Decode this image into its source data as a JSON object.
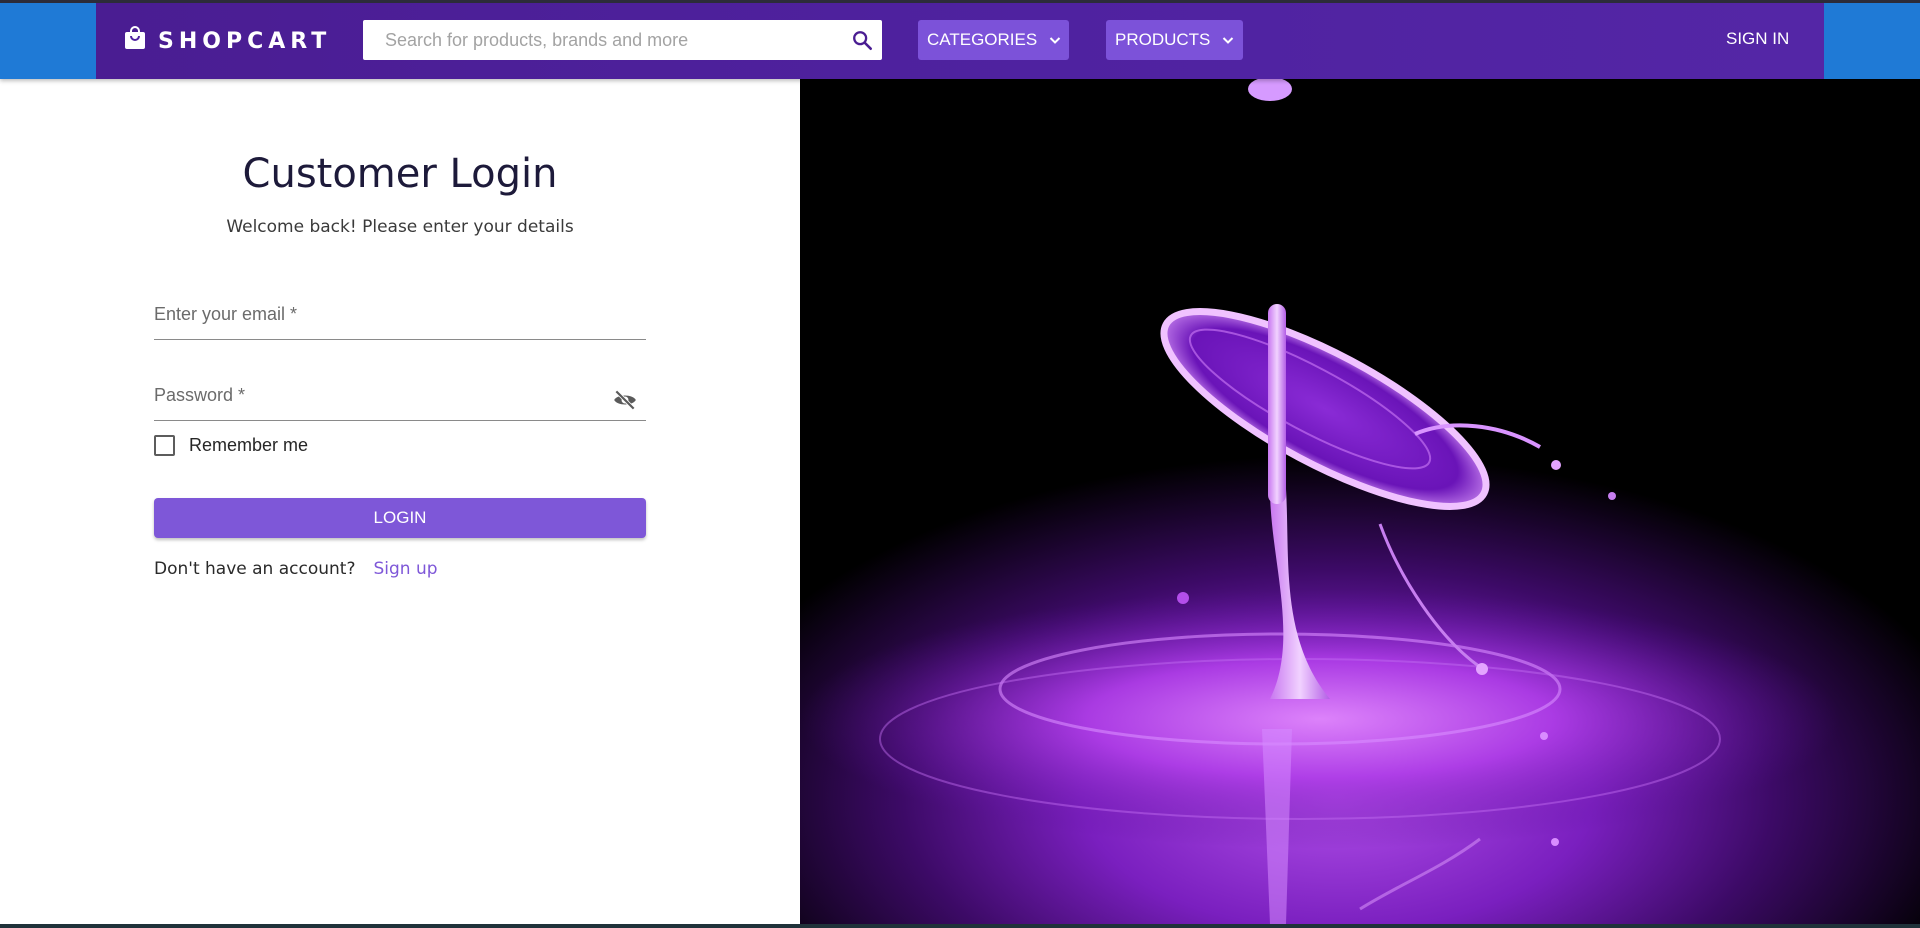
{
  "header": {
    "brand": "SHOPCART",
    "search_placeholder": "Search for products, brands and more",
    "categories_label": "CATEGORIES",
    "products_label": "PRODUCTS",
    "signin_label": "SIGN IN"
  },
  "login": {
    "title": "Customer Login",
    "subtitle": "Welcome back! Please enter your details",
    "email_label": "Enter your email *",
    "password_label": "Password *",
    "remember_label": "Remember me",
    "login_button": "LOGIN",
    "signup_prompt": "Don't have an account?",
    "signup_link": "Sign up"
  },
  "colors": {
    "header_bg": "#4f22a0",
    "outer_bar": "#1f7ad6",
    "accent": "#7e57d8",
    "button": "#7c52d9"
  },
  "icons": {
    "brand": "shopping-bag-icon",
    "search": "search-icon",
    "dropdown": "chevron-down-icon",
    "password_toggle": "eye-off-icon"
  }
}
